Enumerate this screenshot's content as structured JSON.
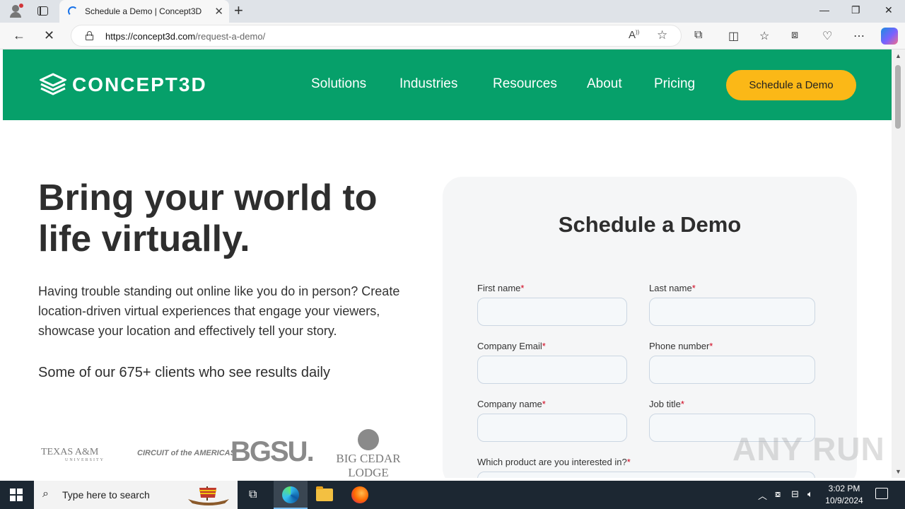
{
  "browser": {
    "tab_title": "Schedule a Demo | Concept3D",
    "new_tab": "+",
    "tab_close": "✕",
    "url_host": "https://concept3d.com",
    "url_path": "/request-a-demo/",
    "win_minimize": "—",
    "win_restore": "❐",
    "win_close": "✕"
  },
  "site": {
    "logo": "CONCEPT3D",
    "nav": [
      "Solutions",
      "Industries",
      "Resources",
      "About",
      "Pricing"
    ],
    "cta": "Schedule a Demo"
  },
  "hero": {
    "title": "Bring your world to life virtually.",
    "body": "Having trouble standing out online like you do in person? Create location-driven virtual experiences that engage your viewers, showcase your location and effectively tell your story.",
    "clients": "Some of our 675+ clients who see results daily"
  },
  "client_logos": {
    "tamu": "TEXAS A&M",
    "tamu_sub": "UNIVERSITY",
    "cota": "CIRCUIT of the AMERICAS",
    "bgsu": "BGSU.",
    "bcl": "BIG CEDAR LODGE"
  },
  "form": {
    "title": "Schedule a Demo",
    "required_mark": "*",
    "fields": {
      "first_name": "First name",
      "last_name": "Last name",
      "company_email": "Company Email",
      "phone_number": "Phone number",
      "company_name": "Company name",
      "job_title": "Job title",
      "product": "Which product are you interested in?"
    }
  },
  "watermark": "ANY RUN",
  "taskbar": {
    "search_placeholder": "Type here to search",
    "time": "3:02 PM",
    "date": "10/9/2024"
  },
  "colors": {
    "brand_green": "#06a06a",
    "cta_yellow": "#fbb817",
    "taskbar": "#1c2732"
  }
}
